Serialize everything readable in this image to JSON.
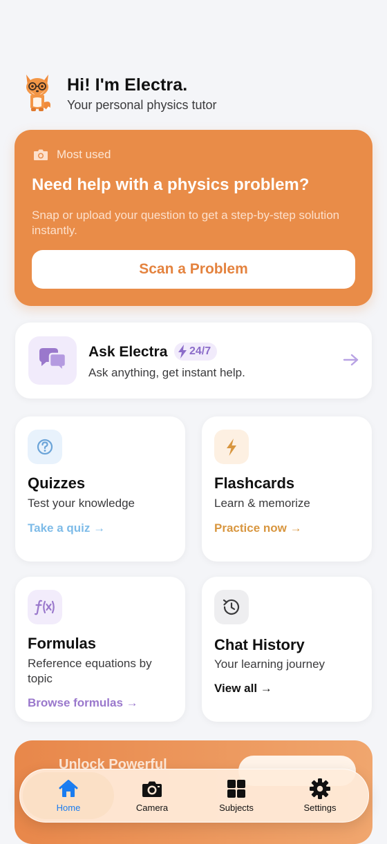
{
  "header": {
    "title": "Hi! I'm Electra.",
    "subtitle": "Your personal physics tutor"
  },
  "scan_card": {
    "badge_icon": "camera-icon",
    "badge": "Most used",
    "title": "Need help with a physics problem?",
    "description": "Snap or upload your question to get a step-by-step solution instantly.",
    "button": "Scan a Problem",
    "color": "#e98c48"
  },
  "ask_card": {
    "icon": "chat-bubbles-icon",
    "title": "Ask Electra",
    "badge": "24/7",
    "subtitle": "Ask anything, get instant help."
  },
  "cards": {
    "quizzes": {
      "icon": "question-circle-icon",
      "title": "Quizzes",
      "subtitle": "Test your knowledge",
      "link": "Take a quiz →",
      "color": "#6cb4e6"
    },
    "flashcards": {
      "icon": "lightning-icon",
      "title": "Flashcards",
      "subtitle": "Learn & memorize",
      "link": "Practice now →",
      "color": "#d8963f"
    },
    "formulas": {
      "icon": "function-icon",
      "title": "Formulas",
      "subtitle": "Reference equations by topic",
      "link": "Browse formulas →",
      "color": "#9a78cc"
    },
    "history": {
      "icon": "history-clock-icon",
      "title": "Chat History",
      "subtitle": "Your learning journey",
      "link": "View all →",
      "color": "#111111"
    }
  },
  "promo": {
    "text": "Unlock Powerful"
  },
  "nav": {
    "items": [
      {
        "label": "Home",
        "icon": "home-icon",
        "active": true
      },
      {
        "label": "Camera",
        "icon": "camera-icon"
      },
      {
        "label": "Subjects",
        "icon": "grid-icon"
      },
      {
        "label": "Settings",
        "icon": "gear-icon"
      }
    ]
  }
}
